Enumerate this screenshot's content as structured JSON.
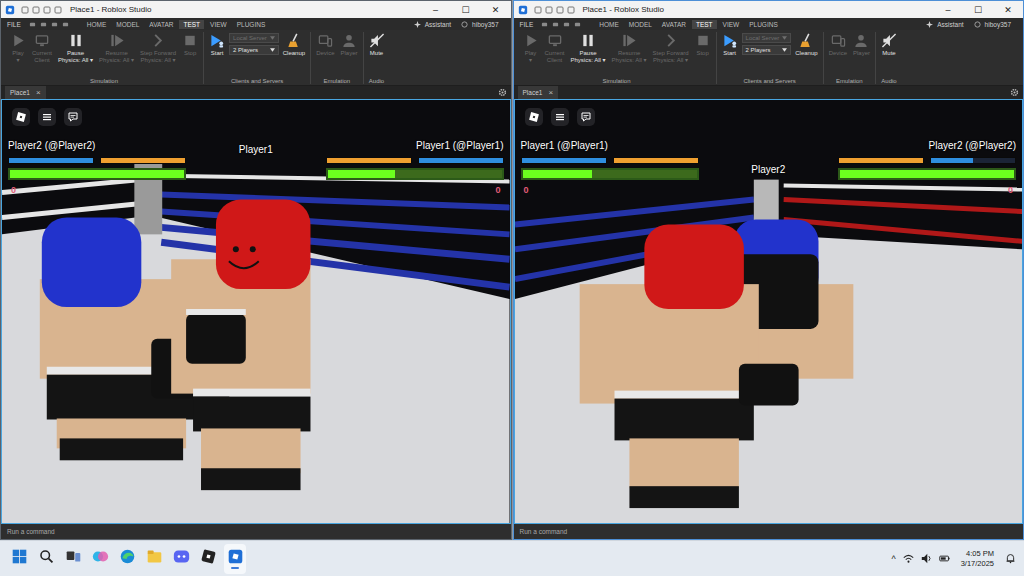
{
  "windows": [
    {
      "title": "Place1 - Roblox Studio",
      "controls": [
        "–",
        "☐",
        "✕"
      ],
      "menu": {
        "file": "FILE",
        "tabs": [
          {
            "label": "HOME",
            "selected": false
          },
          {
            "label": "MODEL",
            "selected": false
          },
          {
            "label": "AVATAR",
            "selected": false
          },
          {
            "label": "TEST",
            "selected": true
          },
          {
            "label": "VIEW",
            "selected": false
          },
          {
            "label": "PLUGINS",
            "selected": false
          }
        ],
        "assistant": "Assistant",
        "user": "hiboy357"
      },
      "ribbon": {
        "groups": [
          {
            "label": "Simulation",
            "items": [
              {
                "kind": "button",
                "lines": [
                  "Play",
                  "▾"
                ],
                "disabled": true
              },
              {
                "kind": "button",
                "lines": [
                  "Current",
                  "Client"
                ],
                "disabled": true
              },
              {
                "kind": "button",
                "lines": [
                  "Pause",
                  "Physics: All ▾"
                ],
                "disabled": false
              },
              {
                "kind": "button",
                "lines": [
                  "Resume",
                  "Physics: All ▾"
                ],
                "disabled": true
              },
              {
                "kind": "button",
                "lines": [
                  "Step Forward",
                  "Physics: All ▾"
                ],
                "disabled": true
              },
              {
                "kind": "button",
                "lines": [
                  "Stop"
                ],
                "disabled": true
              }
            ]
          },
          {
            "label": "Clients and Servers",
            "items": [
              {
                "kind": "button",
                "lines": [
                  "Start"
                ],
                "disabled": false
              },
              {
                "kind": "stack",
                "fields": [
                  {
                    "value": "Local Server",
                    "disabled": true
                  },
                  {
                    "value": "2 Players",
                    "disabled": false
                  }
                ]
              },
              {
                "kind": "button",
                "lines": [
                  "Cleanup"
                ],
                "disabled": false
              }
            ]
          },
          {
            "label": "Emulation",
            "items": [
              {
                "kind": "button",
                "lines": [
                  "Device"
                ],
                "disabled": true
              },
              {
                "kind": "button",
                "lines": [
                  "Player"
                ],
                "disabled": true
              }
            ]
          },
          {
            "label": "Audio",
            "items": [
              {
                "kind": "button",
                "lines": [
                  "Mute"
                ],
                "disabled": false
              }
            ]
          }
        ]
      },
      "doc_tab": {
        "label": "Place1",
        "close": "×",
        "selected": true
      },
      "hud": {
        "panels": [
          {
            "name": "Player2 (@Player2)",
            "stats": [
              {
                "level": 1,
                "color": "#2f8fe0"
              },
              {
                "level": 1,
                "color": "#f0a030"
              }
            ],
            "health": {
              "level": 1
            },
            "score": "0"
          },
          {
            "name": "Player1 (@Player1)",
            "stats": [
              {
                "level": 1,
                "color": "#f0a030"
              },
              {
                "level": 1,
                "color": "#2f8fe0"
              }
            ],
            "health": {
              "level": 0.39
            },
            "score": "0"
          }
        ],
        "nametag": "Player1"
      },
      "command": {
        "placeholder": "Run a command"
      }
    },
    {
      "title": "Place1 - Roblox Studio",
      "controls": [
        "–",
        "☐",
        "✕"
      ],
      "menu": {
        "file": "FILE",
        "tabs": [
          {
            "label": "HOME",
            "selected": false
          },
          {
            "label": "MODEL",
            "selected": false
          },
          {
            "label": "AVATAR",
            "selected": false
          },
          {
            "label": "TEST",
            "selected": true
          },
          {
            "label": "VIEW",
            "selected": false
          },
          {
            "label": "PLUGINS",
            "selected": false
          }
        ],
        "assistant": "Assistant",
        "user": "hiboy357"
      },
      "ribbon": {
        "groups": [
          {
            "label": "Simulation",
            "items": [
              {
                "kind": "button",
                "lines": [
                  "Play",
                  "▾"
                ],
                "disabled": true
              },
              {
                "kind": "button",
                "lines": [
                  "Current",
                  "Client"
                ],
                "disabled": true
              },
              {
                "kind": "button",
                "lines": [
                  "Pause",
                  "Physics: All ▾"
                ],
                "disabled": false
              },
              {
                "kind": "button",
                "lines": [
                  "Resume",
                  "Physics: All ▾"
                ],
                "disabled": true
              },
              {
                "kind": "button",
                "lines": [
                  "Step Forward",
                  "Physics: All ▾"
                ],
                "disabled": true
              },
              {
                "kind": "button",
                "lines": [
                  "Stop"
                ],
                "disabled": true
              }
            ]
          },
          {
            "label": "Clients and Servers",
            "items": [
              {
                "kind": "button",
                "lines": [
                  "Start"
                ],
                "disabled": false
              },
              {
                "kind": "stack",
                "fields": [
                  {
                    "value": "Local Server",
                    "disabled": true
                  },
                  {
                    "value": "2 Players",
                    "disabled": false
                  }
                ]
              },
              {
                "kind": "button",
                "lines": [
                  "Cleanup"
                ],
                "disabled": false
              }
            ]
          },
          {
            "label": "Emulation",
            "items": [
              {
                "kind": "button",
                "lines": [
                  "Device"
                ],
                "disabled": true
              },
              {
                "kind": "button",
                "lines": [
                  "Player"
                ],
                "disabled": true
              }
            ]
          },
          {
            "label": "Audio",
            "items": [
              {
                "kind": "button",
                "lines": [
                  "Mute"
                ],
                "disabled": false
              }
            ]
          }
        ]
      },
      "doc_tab": {
        "label": "Place1",
        "close": "×",
        "selected": true
      },
      "hud": {
        "panels": [
          {
            "name": "Player1 (@Player1)",
            "stats": [
              {
                "level": 1,
                "color": "#2f8fe0"
              },
              {
                "level": 1,
                "color": "#f0a030"
              }
            ],
            "health": {
              "level": 0.4
            },
            "score": "0"
          },
          {
            "name": "Player2 (@Player2)",
            "stats": [
              {
                "level": 1,
                "color": "#f0a030"
              },
              {
                "level": 0.5,
                "color": "#2f8fe0"
              }
            ],
            "health": {
              "level": 1
            },
            "score": "0"
          }
        ],
        "nametag": "Player2"
      },
      "command": {
        "placeholder": "Run a command"
      }
    }
  ],
  "taskbar": {
    "apps": [
      {
        "selected": false
      },
      {
        "selected": false
      },
      {
        "selected": false
      },
      {
        "selected": false
      },
      {
        "selected": false
      },
      {
        "selected": false
      },
      {
        "selected": false
      },
      {
        "selected": false
      },
      {
        "selected": true
      }
    ],
    "tray": {
      "chevron": "^",
      "time": "4:05 PM",
      "date": "3/17/2025"
    }
  }
}
